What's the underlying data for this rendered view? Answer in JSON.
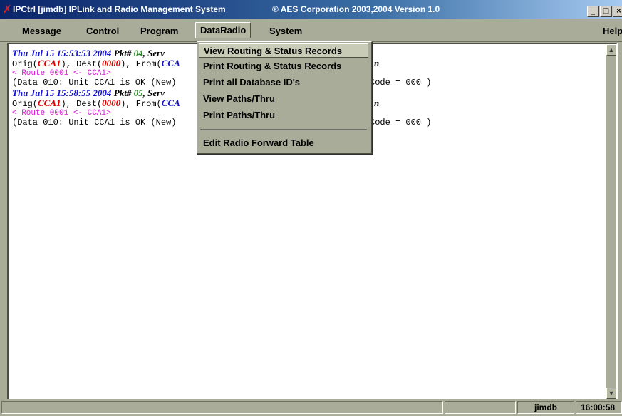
{
  "window": {
    "title": "IPCtrl [jimdb] IPLink and Radio Management System",
    "copyright": "® AES Corporation 2003,2004  Version 1.0",
    "app_icon": "x-icon",
    "buttons": [
      "_",
      "□",
      "×"
    ]
  },
  "menubar": {
    "items": [
      "Message",
      "Control",
      "Program",
      "DataRadio",
      "System"
    ],
    "help": "Help",
    "active": "DataRadio"
  },
  "dropdown": {
    "items": [
      "View Routing & Status Records",
      "Print Routing & Status Records",
      "Print all Database ID's",
      "View Paths/Thru",
      "Print Paths/Thru",
      "Edit Radio Forward Table"
    ]
  },
  "log": {
    "entries": [
      {
        "ts": "Thu Jul 15 15:53:53 2004",
        "pkt_prefix": "Pkt#",
        "pkt": "04",
        "serv": ", Serv",
        "serv_tail": "n",
        "orig_pre": "Orig(",
        "orig": "CCA1",
        "dest_pre": "), Dest(",
        "dest": "0000",
        "from_pre": "), From(",
        "from": "CCA",
        "route": "< Route  0001 <- CCA1>",
        "data": "(Data 010: Unit CCA1 is OK  (New)",
        "code": "Code = 000 )"
      },
      {
        "ts": "Thu Jul 15 15:58:55 2004",
        "pkt_prefix": "Pkt#",
        "pkt": "05",
        "serv": ", Serv",
        "serv_tail": "n",
        "orig_pre": "Orig(",
        "orig": "CCA1",
        "dest_pre": "), Dest(",
        "dest": "0000",
        "from_pre": "), From(",
        "from": "CCA",
        "route": "< Route  0001 <- CCA1>",
        "data": "(Data 010: Unit CCA1 is OK  (New)",
        "code": "Code = 000 )"
      }
    ]
  },
  "status": {
    "user": "jimdb",
    "time": "16:00:58"
  }
}
